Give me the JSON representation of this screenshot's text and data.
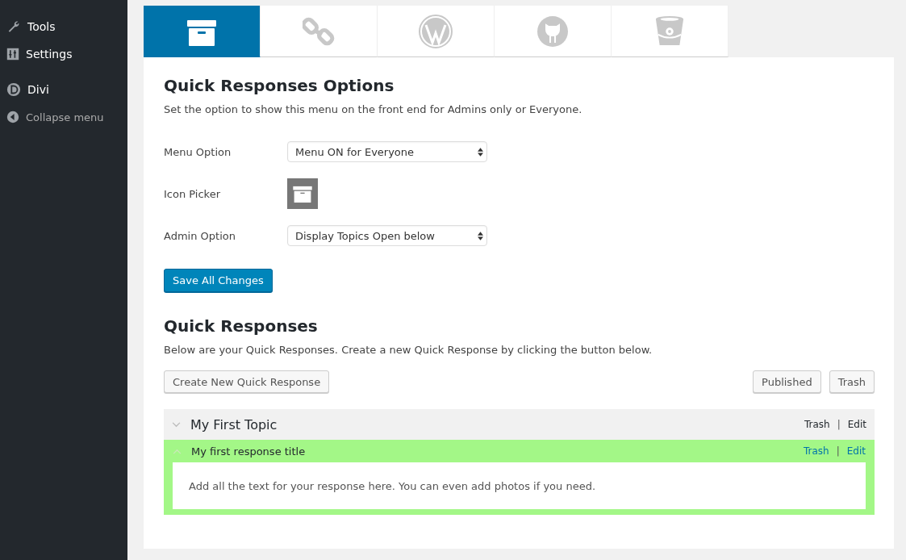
{
  "sidebar": {
    "items": [
      {
        "label": "Tools",
        "kind": "wrench"
      },
      {
        "label": "Settings",
        "kind": "sliders"
      },
      {
        "label": "Divi",
        "kind": "divi"
      },
      {
        "label": "Collapse menu",
        "kind": "collapse"
      }
    ]
  },
  "tabs": [
    {
      "kind": "archive",
      "selected": true
    },
    {
      "kind": "link",
      "selected": false
    },
    {
      "kind": "wordpress",
      "selected": false
    },
    {
      "kind": "github",
      "selected": false
    },
    {
      "kind": "bucket",
      "selected": false
    }
  ],
  "options": {
    "title": "Quick Responses Options",
    "description": "Set the option to show this menu on the front end for Admins only or Everyone.",
    "fields": [
      {
        "kind": "select",
        "label": "Menu Option",
        "value": "Menu ON for Everyone"
      },
      {
        "kind": "icon",
        "label": "Icon Picker"
      },
      {
        "kind": "select",
        "label": "Admin Option",
        "value": "Display Topics Open below"
      }
    ],
    "save_button": "Save All Changes"
  },
  "responses": {
    "title": "Quick Responses",
    "description": "Below are your Quick Responses. Create a new Quick Response by clicking the button below.",
    "create_button": "Create New Quick Response",
    "filters": [
      "Published",
      "Trash"
    ],
    "topics": [
      {
        "title": "My First Topic",
        "actions": [
          "Trash",
          "Edit"
        ],
        "separator": "|",
        "responses": [
          {
            "title": "My first response title",
            "actions": [
              "Trash",
              "Edit"
            ],
            "separator": "|",
            "body": "Add all the text for your response here. You can even add photos if you need."
          }
        ]
      }
    ]
  }
}
